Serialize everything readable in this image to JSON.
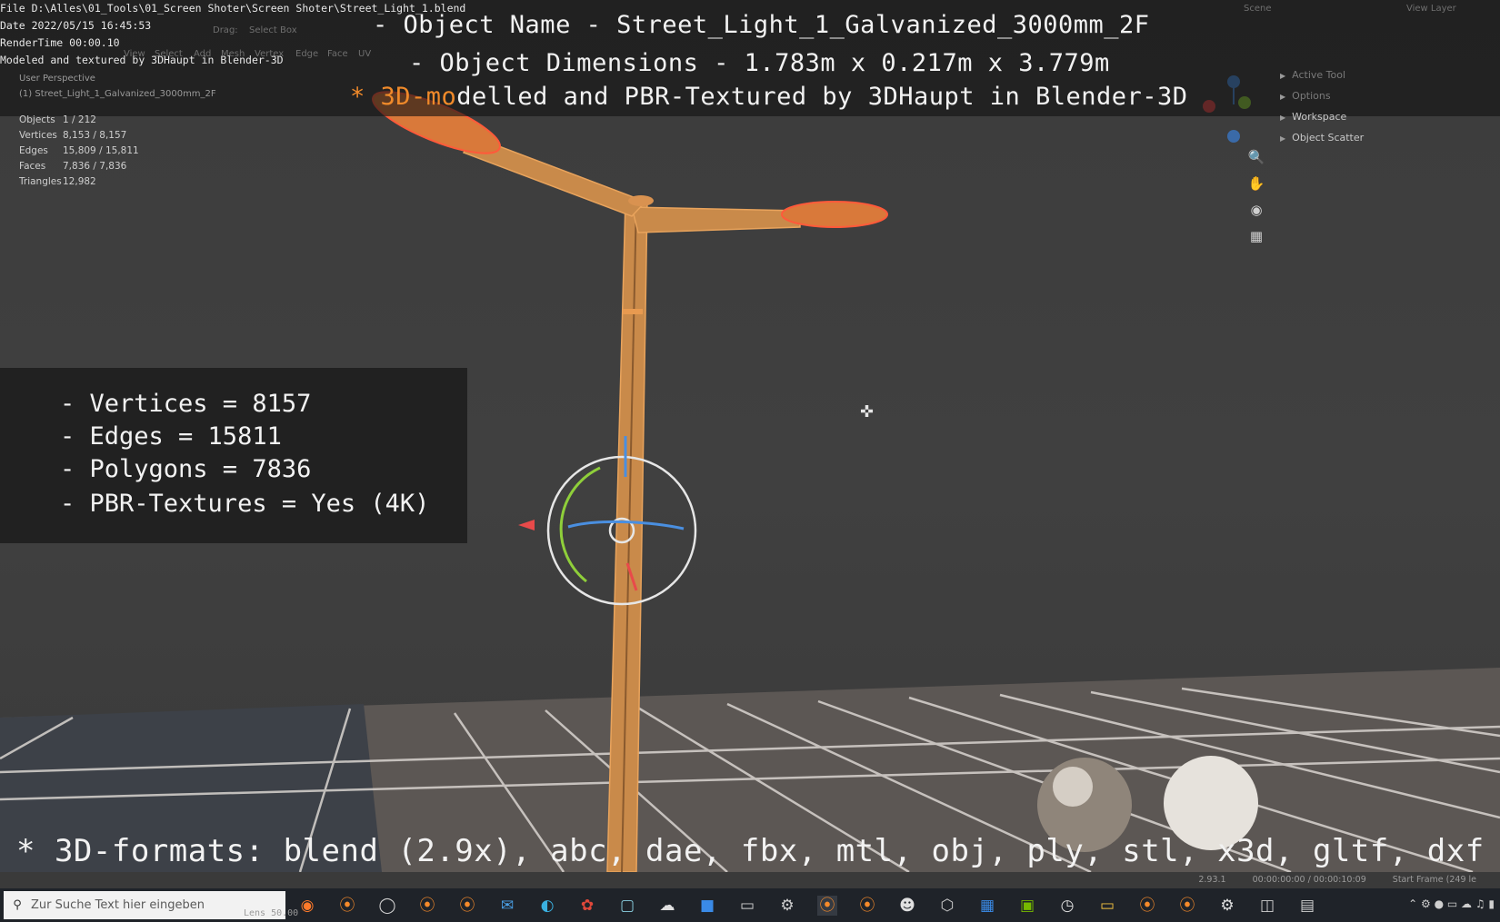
{
  "file_info": {
    "path": "File D:\\Alles\\01_Tools\\01_Screen Shoter\\Screen Shoter\\Street_Light_1.blend",
    "date": "Date 2022/05/15 16:45:53",
    "render_time": "RenderTime 00:00.10",
    "credit": "Modeled and textured by 3DHaupt in Blender-3D"
  },
  "captions": {
    "object_name": "- Object Name - Street_Light_1_Galvanized_3000mm_2F",
    "object_dimensions": "- Object Dimensions -  1.783m x 0.217m x 3.779m",
    "modelled_prefix": "* 3D-mo",
    "modelled_rest": "delled and PBR-Textured by 3DHaupt in Blender-3D"
  },
  "viewport": {
    "perspective": "User Perspective",
    "collection": "(1) Street_Light_1_Galvanized_3000mm_2F",
    "stats": [
      {
        "label": "Objects",
        "value": "1 / 212"
      },
      {
        "label": "Vertices",
        "value": "8,153 / 8,157"
      },
      {
        "label": "Edges",
        "value": "15,809 / 15,811"
      },
      {
        "label": "Faces",
        "value": "7,836 / 7,836"
      },
      {
        "label": "Triangles",
        "value": "12,982"
      }
    ],
    "header_ghost": {
      "drag": "Drag:",
      "select_box": "Select Box",
      "view": "View",
      "select": "Select",
      "add": "Add",
      "mesh": "Mesh",
      "vertex": "Vertex",
      "edge": "Edge",
      "face": "Face",
      "uv": "UV",
      "scene": "Scene",
      "view_layer": "View Layer"
    }
  },
  "info_box": {
    "vertices": "- Vertices = 8157",
    "edges": "- Edges = 15811",
    "polygons": "- Polygons = 7836",
    "pbr": "- PBR-Textures =  Yes (4K)"
  },
  "right_panel": {
    "items": [
      "Active Tool",
      "Options",
      "Workspace",
      "Object Scatter"
    ]
  },
  "nav_icons": [
    "zoom-icon",
    "hand-pan-icon",
    "camera-icon",
    "grid-ortho-icon"
  ],
  "formats_caption": "* 3D-formats: blend (2.9x), abc, dae, fbx, mtl, obj, ply, stl, x3d, gltf, dxf",
  "status_bar": {
    "version": "2.93.1",
    "time": "00:00:00:00 / 00:00:10:09",
    "start_frame": "Start Frame (249 le",
    "lens": "Lens 50.00"
  },
  "taskbar": {
    "search_placeholder": "Zur Suche Text hier eingeben",
    "icons": [
      "firefox-icon",
      "blender-icon",
      "obs-icon",
      "blender-icon",
      "blender-icon",
      "mail-icon",
      "edge-icon",
      "app-red-icon",
      "notes-icon",
      "chat-icon",
      "app-blue-icon",
      "terminal-icon",
      "tool-icon",
      "blender-icon",
      "blender-icon",
      "panda-icon",
      "cube-icon",
      "calendar-icon",
      "nvidia-icon",
      "clock-icon",
      "folder-icon",
      "blender-icon",
      "blender-icon",
      "settings-icon",
      "app-window-icon",
      "app-window2-icon"
    ]
  },
  "colors": {
    "accent": "#f08a2a",
    "pole": "#c98a4a",
    "background": "#3a3a3a",
    "taskbar": "#1f2329"
  }
}
